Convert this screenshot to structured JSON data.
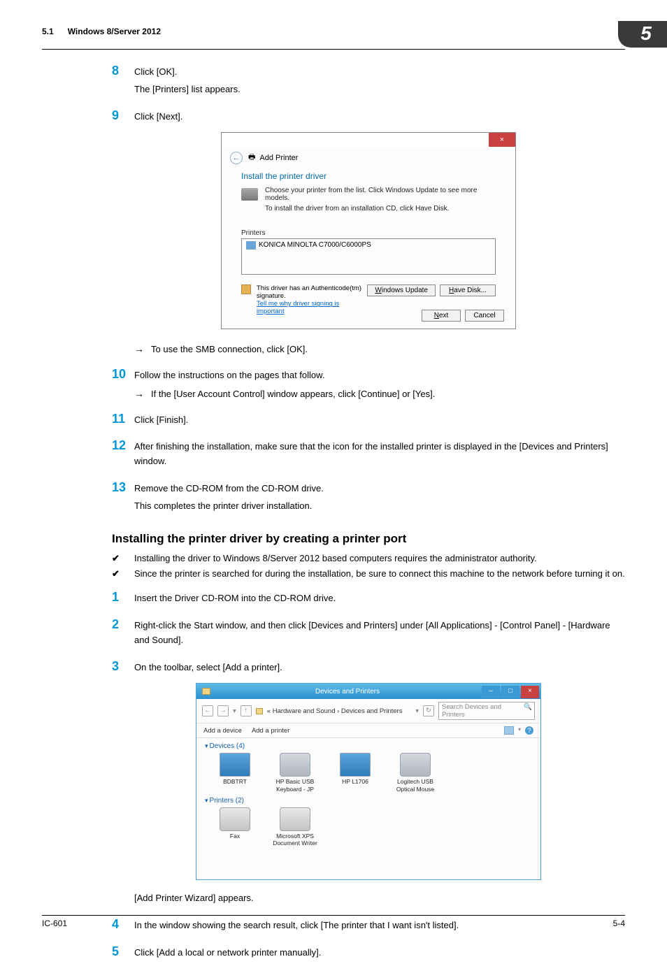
{
  "header": {
    "section_num": "5.1",
    "section_title": "Windows 8/Server 2012",
    "chapter": "5"
  },
  "steps_a": {
    "s8": {
      "text": "Click [OK].",
      "text2": "The [Printers] list appears."
    },
    "s9": {
      "text": "Click [Next].",
      "arrow": "To use the SMB connection, click [OK]."
    },
    "s10": {
      "text": "Follow the instructions on the pages that follow.",
      "arrow": "If the [User Account Control] window appears, click [Continue] or [Yes]."
    },
    "s11": {
      "text": "Click [Finish]."
    },
    "s12": {
      "text": "After finishing the installation, make sure that the icon for the installed printer is displayed in the [Devices and Printers] window."
    },
    "s13": {
      "text": "Remove the CD-ROM from the CD-ROM drive.",
      "text2": "This completes the printer driver installation."
    }
  },
  "section2": {
    "title": "Installing the printer driver by creating a printer port",
    "check1": "Installing the driver to Windows 8/Server 2012 based computers requires the administrator authority.",
    "check2": "Since the printer is searched for during the installation, be sure to connect this machine to the network before turning it on."
  },
  "steps_b": {
    "s1": {
      "text": "Insert the Driver CD-ROM into the CD-ROM drive."
    },
    "s2": {
      "text": "Right-click the Start window, and then click [Devices and Printers] under [All Applications] - [Control Panel] - [Hardware and Sound]."
    },
    "s3": {
      "text": "On the toolbar, select [Add a printer].",
      "after": "[Add Printer Wizard] appears."
    },
    "s4": {
      "text": "In the window showing the search result, click [The printer that I want isn't listed]."
    },
    "s5": {
      "text": "Click [Add a local or network printer manually]."
    }
  },
  "dialog1": {
    "back": "←",
    "printer_icon_label": "🖶",
    "title": "Add Printer",
    "heading": "Install the printer driver",
    "line1": "Choose your printer from the list. Click Windows Update to see more models.",
    "line2": "To install the driver from an installation CD, click Have Disk.",
    "list_label": "Printers",
    "list_item": "KONICA MINOLTA C7000/C6000PS",
    "sig_text": "This driver has an Authenticode(tm) signature.",
    "sig_link": "Tell me why driver signing is important",
    "btn_wu": "Windows Update",
    "btn_hd": "Have Disk...",
    "btn_next": "Next",
    "btn_cancel": "Cancel",
    "close": "×"
  },
  "dialog2": {
    "title": "Devices and Printers",
    "path": "« Hardware and Sound › Devices and Printers",
    "search_placeholder": "Search Devices and Printers",
    "tb_add_device": "Add a device",
    "tb_add_printer": "Add a printer",
    "grp_devices": "Devices (4)",
    "grp_printers": "Printers (2)",
    "dev1": "BDBTRT",
    "dev2": "HP Basic USB Keyboard - JP",
    "dev3": "HP L1706",
    "dev4": "Logitech USB Optical Mouse",
    "prn1": "Fax",
    "prn2": "Microsoft XPS Document Writer",
    "min": "–",
    "max": "□",
    "close": "×",
    "nav_back": "←",
    "nav_fwd": "→",
    "nav_up": "↑",
    "refresh": "↻",
    "search_icon": "🔍",
    "help": "?"
  },
  "footer": {
    "left": "IC-601",
    "right": "5-4"
  }
}
